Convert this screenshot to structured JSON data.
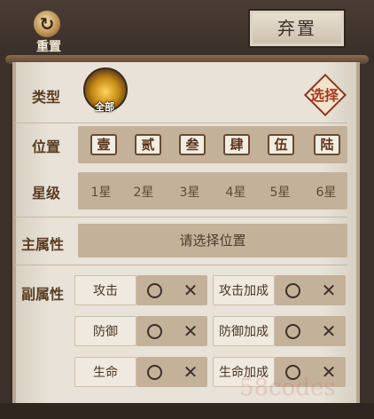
{
  "header": {
    "reset_label": "重置",
    "reset_icon": "refresh-icon",
    "discard_label": "弃置"
  },
  "filters": {
    "type_label": "类型",
    "type_value": "全部",
    "select_label": "选择",
    "position_label": "位置",
    "positions": [
      "壹",
      "贰",
      "叁",
      "肆",
      "伍",
      "陆"
    ],
    "star_label": "星级",
    "stars": [
      "1星",
      "2星",
      "3星",
      "4星",
      "5星",
      "6星"
    ],
    "main_attr_label": "主属性",
    "main_attr_placeholder": "请选择位置",
    "sub_attr_label": "副属性",
    "sub_attrs": [
      "攻击",
      "攻击加成",
      "防御",
      "防御加成",
      "生命",
      "生命加成"
    ],
    "circle_symbol": "O",
    "cross_symbol": "✕"
  },
  "watermark": "58codes",
  "colors": {
    "accent_text": "#5a3d22",
    "bar_bg": "#c3b19a",
    "select_red": "#a23a1e"
  }
}
